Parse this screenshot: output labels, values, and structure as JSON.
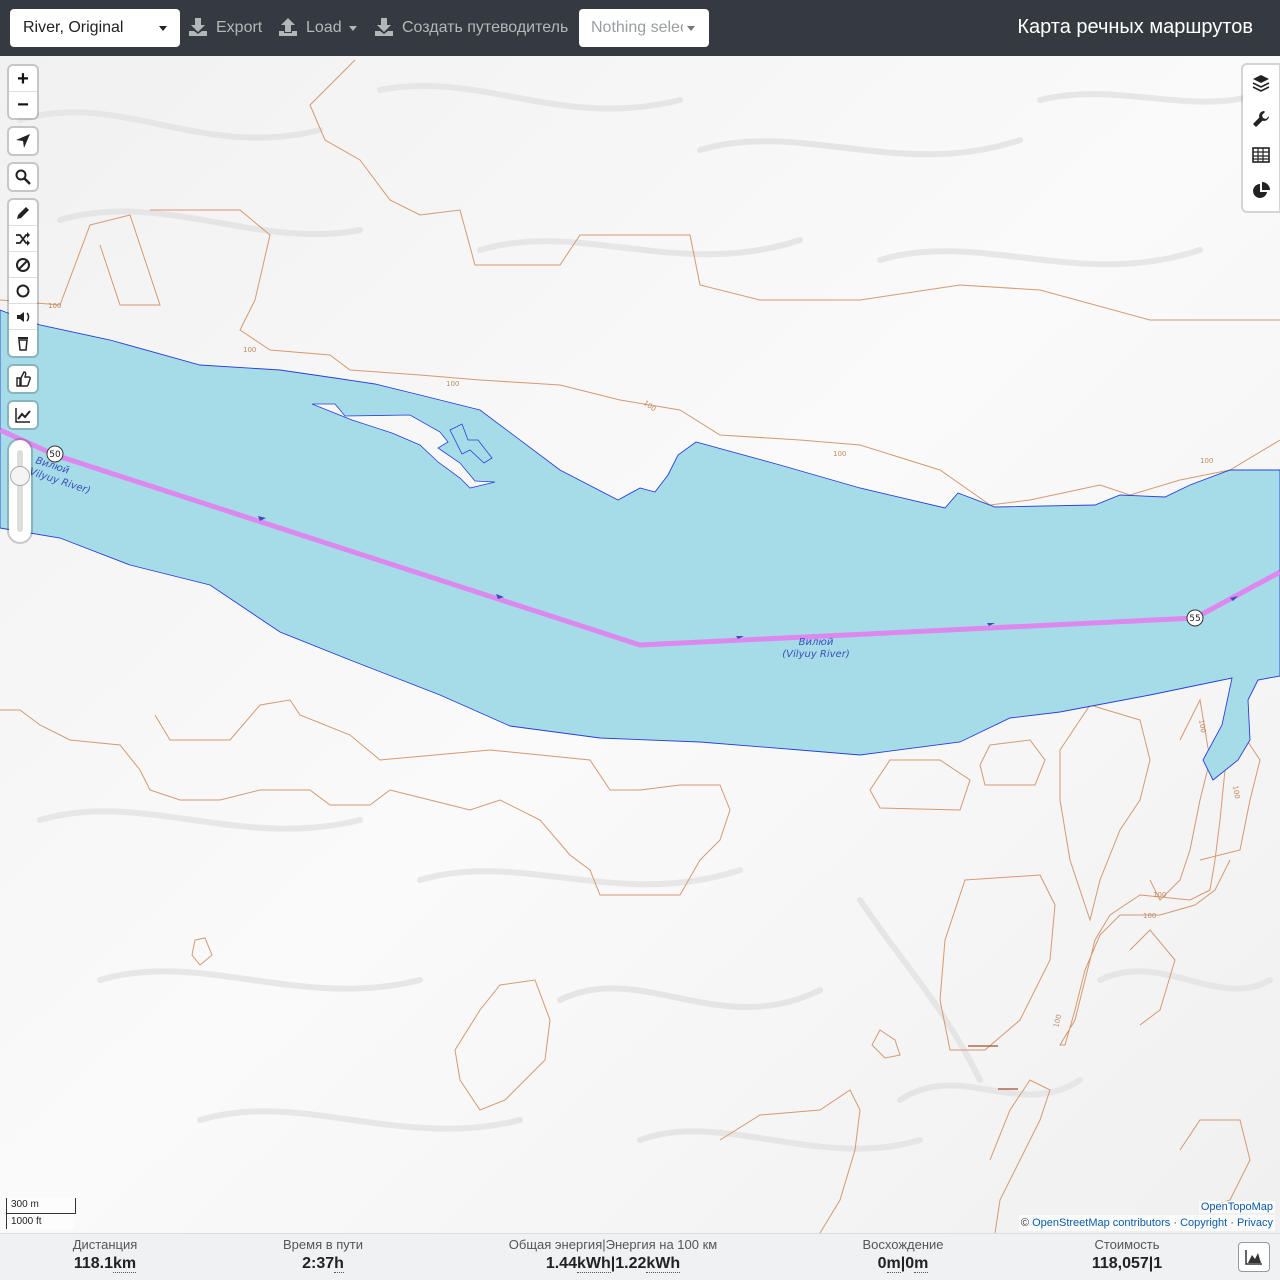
{
  "navbar": {
    "profile_value": "River, Original",
    "export_label": "Export",
    "load_label": "Load",
    "roadbook_label": "Создать путеводитель",
    "segments_value": "Nothing selected",
    "brand_title": "Карта речных маршрутов"
  },
  "map": {
    "river_name_ru": "Вилюй",
    "river_name_en": "(Vilyuy River)",
    "river_name_left_ru": "Вилюй",
    "river_name_left_en": "(Vilyuy River)",
    "km_markers": [
      "50",
      "55"
    ],
    "contour_labels": [
      "100",
      "100",
      "100",
      "100",
      "100",
      "100",
      "100",
      "100",
      "100",
      "100",
      "100"
    ],
    "colors": {
      "water": "#a6dce8",
      "route": "#dd88ee",
      "contour": "#d49a72",
      "shore": "#2a3fd6"
    }
  },
  "controls": {
    "zoom_in": "+",
    "zoom_out": "−",
    "icons": [
      "locate-icon",
      "search-icon",
      "draw-icon",
      "reverse-icon",
      "nogo-icon",
      "circle-icon",
      "poi-icon",
      "trash-icon",
      "thumb-icon",
      "chart-icon"
    ]
  },
  "sidebar": {
    "tabs": [
      "layers-icon",
      "wrench-icon",
      "table-icon",
      "pie-icon"
    ]
  },
  "scale": {
    "metric": "300 m",
    "imperial": "1000 ft"
  },
  "attribution": {
    "top": "OpenTopoMap",
    "copyright_symbol": "©",
    "osm": "OpenStreetMap contributors",
    "sep1": "·",
    "copyright": "Copyright",
    "sep2": "·",
    "privacy": "Privacy"
  },
  "stats": {
    "distance": {
      "label": "Дистанция",
      "value": "118.1",
      "unit": "km"
    },
    "time": {
      "label": "Время в пути",
      "value": "2:37",
      "unit": "h"
    },
    "energy": {
      "label": "Общая энергия",
      "label_sep": "|",
      "label2": "Энергия на 100 км",
      "value": "1.44",
      "unit": "kWh",
      "sep": "|",
      "value2": "1.22",
      "unit2": "kWh"
    },
    "ascent": {
      "label": "Восхождение",
      "value": "0",
      "unit": "m",
      "sep": "|",
      "value2": "0",
      "unit2": "m"
    },
    "cost": {
      "label": "Стоимость",
      "value": "118,057",
      "sep": "|",
      "value2": "1"
    }
  }
}
